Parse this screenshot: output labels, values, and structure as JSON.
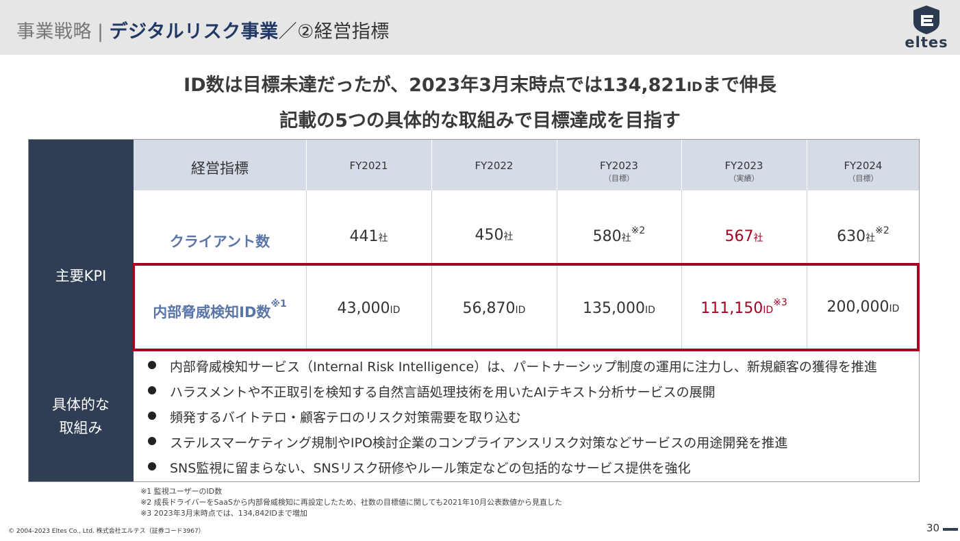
{
  "header": {
    "section": "事業戦略",
    "separator": "|",
    "title": "デジタルリスク事業",
    "subtitle": "／②経営指標",
    "logo_text": "eltes"
  },
  "headline": {
    "line1_pre": "ID数は目標未達だったが、2023年3月末時点では134,821",
    "line1_unit": "ID",
    "line1_post": "まで伸長",
    "line2": "記載の5つの具体的な取組みで目標達成を目指す"
  },
  "table": {
    "header_label": "経営指標",
    "columns": [
      {
        "fy": "FY2021",
        "note": ""
      },
      {
        "fy": "FY2022",
        "note": ""
      },
      {
        "fy": "FY2023",
        "note": "（目標）"
      },
      {
        "fy": "FY2023",
        "note": "（実績）"
      },
      {
        "fy": "FY2024",
        "note": "（目標）"
      }
    ],
    "kpi_group_label": "主要KPI",
    "rows": [
      {
        "label": "クライアント数",
        "label_sup": "",
        "cells": [
          {
            "value": "441",
            "unit": "社",
            "sup": "",
            "highlight": false
          },
          {
            "value": "450",
            "unit": "社",
            "sup": "",
            "highlight": false
          },
          {
            "value": "580",
            "unit": "社",
            "sup": "※2",
            "highlight": false
          },
          {
            "value": "567",
            "unit": "社",
            "sup": "",
            "highlight": true
          },
          {
            "value": "630",
            "unit": "社",
            "sup": "※2",
            "highlight": false
          }
        ]
      },
      {
        "label": "内部脅威検知ID数",
        "label_sup": "※1",
        "cells": [
          {
            "value": "43,000",
            "unit": "ID",
            "sup": "",
            "highlight": false
          },
          {
            "value": "56,870",
            "unit": "ID",
            "sup": "",
            "highlight": false
          },
          {
            "value": "135,000",
            "unit": "ID",
            "sup": "",
            "highlight": false
          },
          {
            "value": "111,150",
            "unit": "ID",
            "sup": "※3",
            "highlight": true
          },
          {
            "value": "200,000",
            "unit": "ID",
            "sup": "",
            "highlight": false
          }
        ]
      }
    ],
    "initiatives_label_1": "具体的な",
    "initiatives_label_2": "取組み",
    "initiatives": [
      "内部脅威検知サービス（Internal Risk Intelligence）は、パートナーシップ制度の運用に注力し、新規顧客の獲得を推進",
      "ハラスメントや不正取引を検知する自然言語処理技術を用いたAIテキスト分析サービスの展開",
      "頻発するバイトテロ・顧客テロのリスク対策需要を取り込む",
      "ステルスマーケティング規制やIPO検討企業のコンプライアンスリスク対策などサービスの用途開発を推進",
      "SNS監視に留まらない、SNSリスク研修やルール策定などの包括的なサービス提供を強化"
    ]
  },
  "footnotes": [
    "※1 監視ユーザーのID数",
    "※2 成長ドライバーをSaaSから内部脅威検知に再設定したため、社数の目標値に関しても2021年10月公表数値から見直した",
    "※3 2023年3月末時点では、134,842IDまで増加"
  ],
  "footer": {
    "copyright": "© 2004-2023 Eltes Co., Ltd.  株式会社エルテス（証券コード3967）",
    "page_number": "30"
  },
  "colors": {
    "navy": "#2f3d55",
    "header_row": "#d5dbe7",
    "label_blue": "#5a76a8",
    "accent_red": "#a50021"
  }
}
